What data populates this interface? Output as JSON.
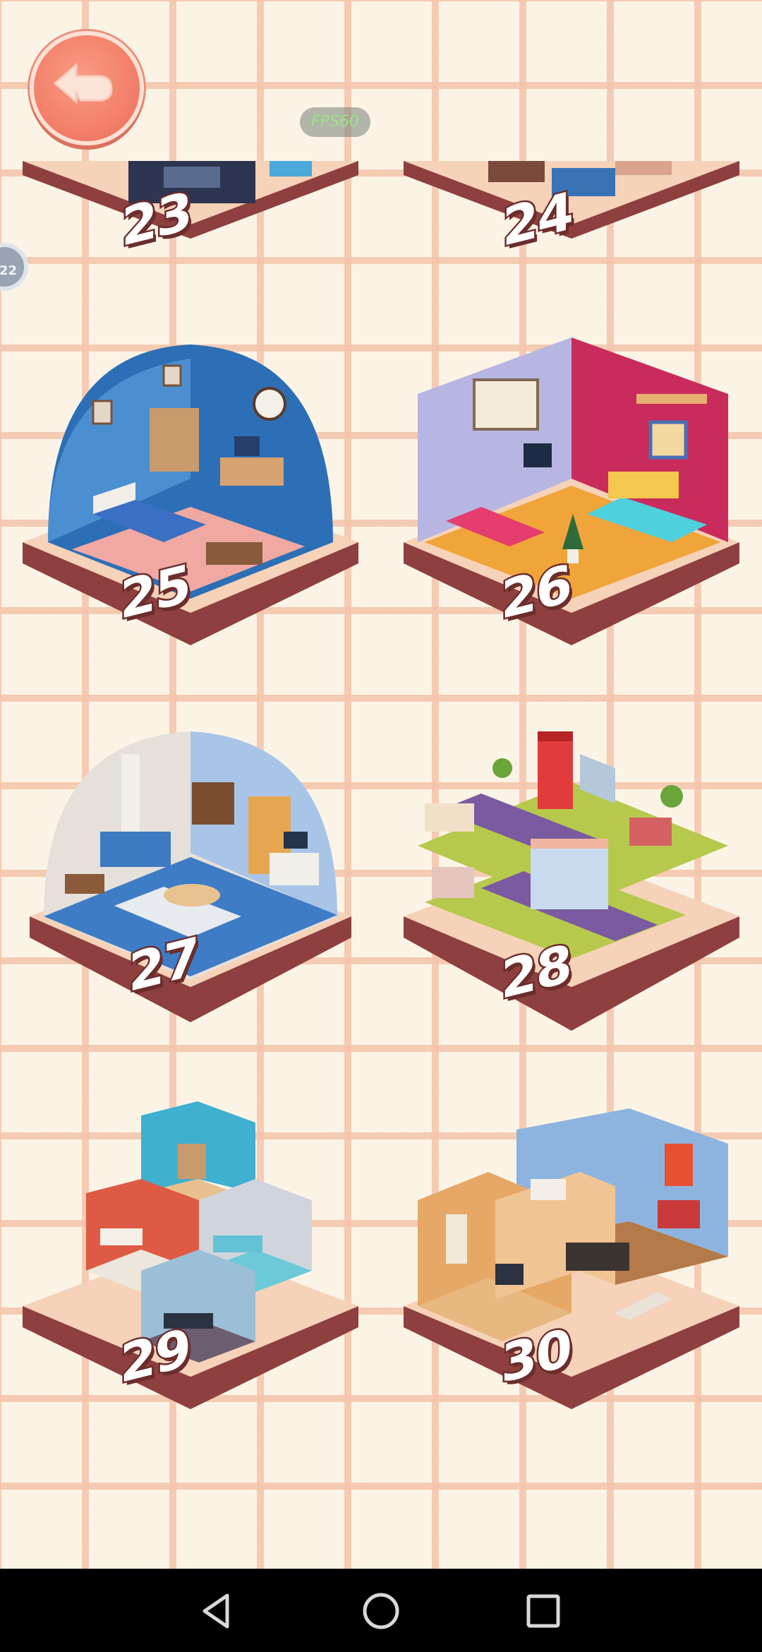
{
  "header": {
    "back_icon": "back-arrow-icon",
    "fps_label": "FPS60"
  },
  "edge_badge_label": "22",
  "levels": [
    {
      "number": "23",
      "theme": "living-room",
      "status": "partial"
    },
    {
      "number": "24",
      "theme": "living-room",
      "status": "partial"
    },
    {
      "number": "25",
      "theme": "blue-bedroom"
    },
    {
      "number": "26",
      "theme": "christmas-bedroom"
    },
    {
      "number": "27",
      "theme": "blue-living-room"
    },
    {
      "number": "28",
      "theme": "town-block"
    },
    {
      "number": "29",
      "theme": "multi-room-house"
    },
    {
      "number": "30",
      "theme": "two-storey-house"
    }
  ],
  "navbar": {
    "back_icon": "triangle-back-icon",
    "home_icon": "circle-home-icon",
    "recents_icon": "square-recents-icon"
  },
  "colors": {
    "background": "#fbf4e6",
    "grid_line": "#f4c4aa",
    "platform_top": "#f6d2b8",
    "platform_side": "#8e3f3f",
    "back_button": "#f3806a"
  }
}
